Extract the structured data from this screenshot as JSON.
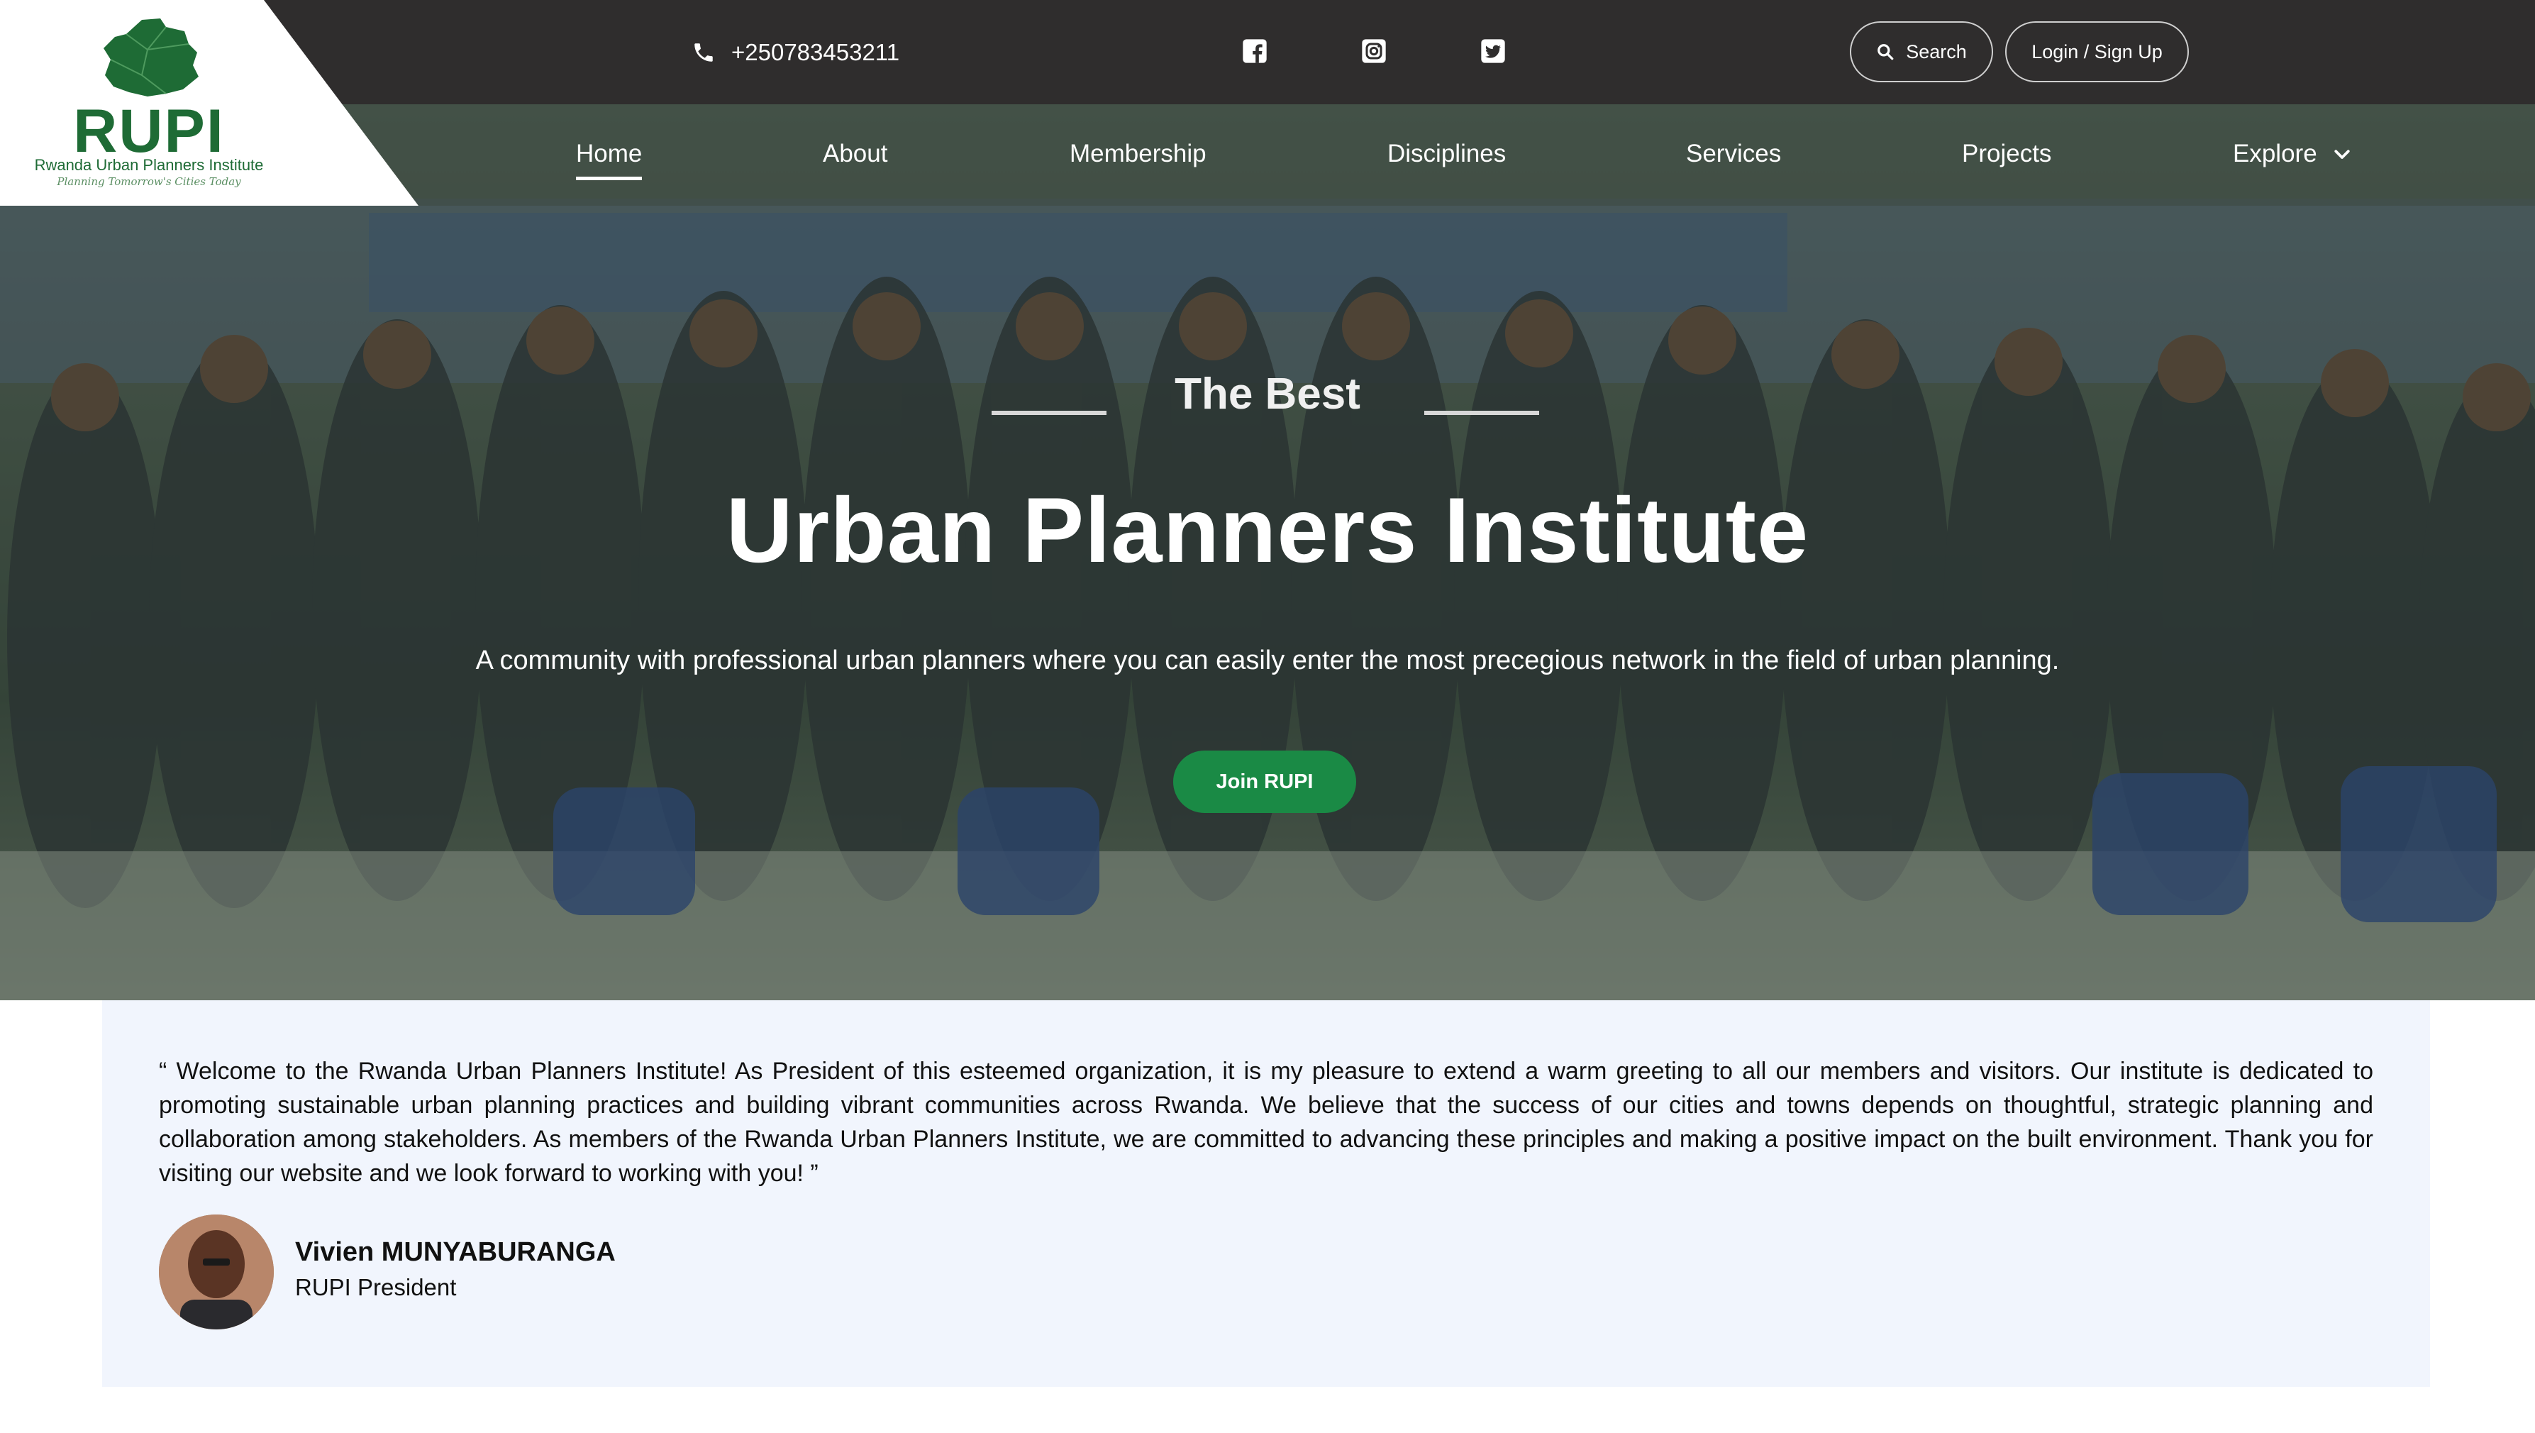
{
  "topbar": {
    "phone": "+250783453211",
    "social": [
      "facebook-icon",
      "instagram-icon",
      "twitter-icon"
    ],
    "search_label": "Search",
    "login_label": "Login / Sign Up"
  },
  "logo": {
    "name": "RUPI",
    "full_name": "Rwanda Urban Planners Institute",
    "tagline": "Planning Tomorrow's Cities Today"
  },
  "nav": {
    "items": [
      {
        "label": "Home",
        "active": true
      },
      {
        "label": "About"
      },
      {
        "label": "Membership"
      },
      {
        "label": "Disciplines"
      },
      {
        "label": "Services"
      },
      {
        "label": "Projects"
      },
      {
        "label": "Explore",
        "has_dropdown": true
      }
    ]
  },
  "hero": {
    "eyebrow": "The Best",
    "title": "Urban Planners Institute",
    "description": "A community with professional urban planners where you can easily enter the most precegious network in the field of urban planning.",
    "cta_label": "Join RUPI"
  },
  "message": {
    "quote": "“ Welcome to the Rwanda Urban Planners Institute! As President of this esteemed organization, it is my pleasure to extend a warm greeting to all our members and visitors. Our institute is dedicated to promoting sustainable urban planning practices and building vibrant communities across Rwanda. We believe that the success of our cities and towns depends on thoughtful, strategic planning and collaboration among stakeholders. As members of the Rwanda Urban Planners Institute, we are committed to advancing these principles and making a positive impact on the built environment. Thank you for visiting our website and we look forward to working with you! ”",
    "name": "Vivien MUNYABURANGA",
    "role": "RUPI President"
  },
  "colors": {
    "brand_green": "#1e6b35",
    "cta_green": "#1a8a45",
    "topbar": "#2f2d2d",
    "message_bg": "#f1f5fd"
  }
}
